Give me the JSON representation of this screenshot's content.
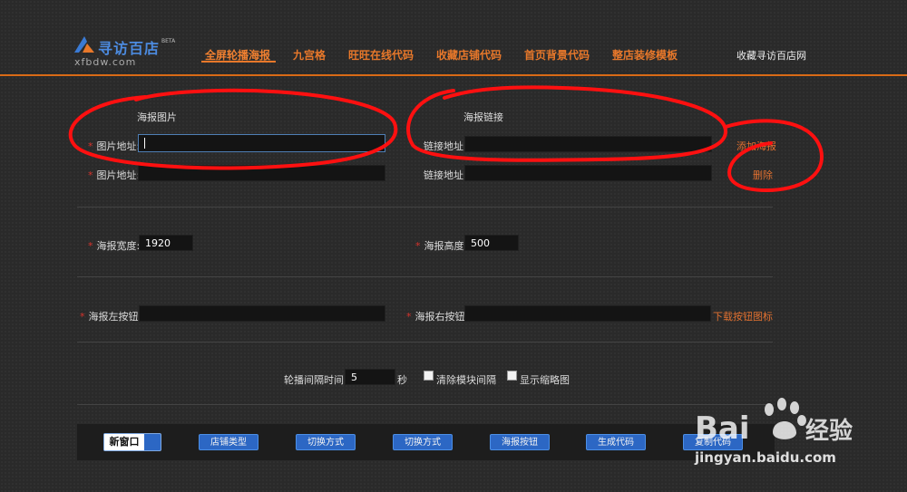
{
  "header": {
    "logo_text": "寻访百店",
    "logo_beta": "BETA",
    "logo_sub": "xfbdw.com",
    "nav": [
      "全屏轮播海报",
      "九宫格",
      "旺旺在线代码",
      "收藏店铺代码",
      "首页背景代码",
      "整店装修模板"
    ],
    "favorite": "收藏寻访百店网"
  },
  "form": {
    "col_poster_image": "海报图片",
    "col_poster_link": "海报链接",
    "req_mark": "*",
    "image_addr_label": "图片地址:",
    "link_addr_label": "链接地址:",
    "add_poster": "添加海报",
    "delete": "删除",
    "width_label": "海报宽度:",
    "width_value": "1920",
    "height_label": "海报高度:",
    "height_value": "500",
    "left_btn_label": "海报左按钮:",
    "right_btn_label": "海报右按钮:",
    "download_btn_icon": "下载按钮图标",
    "interval_label": "轮播间隔时间:",
    "interval_value": "5",
    "interval_unit": "秒",
    "clear_spacing": "清除模块间隔",
    "show_thumbs": "显示缩略图"
  },
  "footer": {
    "new_window": "新窗口",
    "buttons": [
      "店铺类型",
      "切换方式",
      "切换方式",
      "海报按钮",
      "生成代码",
      "复制代码"
    ]
  },
  "watermark": {
    "brand": "Bai",
    "brand2": "经验",
    "url": "jingyan.baidu.com"
  },
  "colors": {
    "accent": "#e8782a",
    "annotation": "#ff1010",
    "button_blue": "#2c67c4"
  }
}
